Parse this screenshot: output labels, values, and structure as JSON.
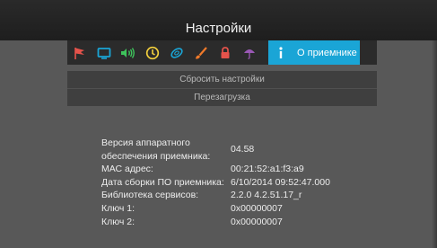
{
  "header": {
    "title": "Настройки"
  },
  "tabs": {
    "icons": [
      {
        "name": "flag-icon",
        "color": "#e5534b"
      },
      {
        "name": "tv-icon",
        "color": "#1aa5d6"
      },
      {
        "name": "sound-icon",
        "color": "#3ec35b"
      },
      {
        "name": "clock-icon",
        "color": "#f3d03d"
      },
      {
        "name": "network-icon",
        "color": "#1aa5d6"
      },
      {
        "name": "brush-icon",
        "color": "#f07a2a"
      },
      {
        "name": "lock-icon",
        "color": "#e5534b"
      },
      {
        "name": "parental-icon",
        "color": "#9b59b6"
      }
    ],
    "active": {
      "icon": "info-icon",
      "label": "О приемнике",
      "color": "#1aa5d6"
    }
  },
  "menu": {
    "reset_label": "Сбросить настройки",
    "reboot_label": "Перезагрузка"
  },
  "info": {
    "rows": [
      {
        "key": "Версия аппаратного обеспечения приемника:",
        "value": "04.58"
      },
      {
        "key": "МАС адрес:",
        "value": "00:21:52:a1:f3:a9"
      },
      {
        "key": "Дата сборки ПО приемника:",
        "value": "6/10/2014 09:52:47.000"
      },
      {
        "key": "Библиотека сервисов:",
        "value": "2.2.0 4.2.51.17_r"
      },
      {
        "key": "Ключ 1:",
        "value": "0x00000007"
      },
      {
        "key": "Ключ 2:",
        "value": "0x00000007"
      }
    ]
  }
}
